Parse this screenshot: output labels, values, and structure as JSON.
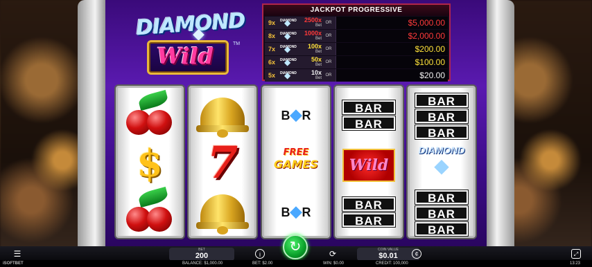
{
  "logo": {
    "title": "DIAMOND",
    "subtitle": "Wild",
    "tm": "TM"
  },
  "jackpot": {
    "title": "JACKPOT PROGRESSIVE",
    "rows": [
      {
        "mult": "9x",
        "bet": "2500x",
        "bet_label": "Bet",
        "or": "OR",
        "value": "$5,000.00",
        "color": "#ff3a3a"
      },
      {
        "mult": "8x",
        "bet": "1000x",
        "bet_label": "Bet",
        "or": "OR",
        "value": "$2,000.00",
        "color": "#ff3a3a"
      },
      {
        "mult": "7x",
        "bet": "100x",
        "bet_label": "Bet",
        "or": "OR",
        "value": "$200.00",
        "color": "#ffe23a"
      },
      {
        "mult": "6x",
        "bet": "50x",
        "bet_label": "Bet",
        "or": "OR",
        "value": "$100.00",
        "color": "#ffe23a"
      },
      {
        "mult": "5x",
        "bet": "10x",
        "bet_label": "Bet",
        "or": "OR",
        "value": "$20.00",
        "color": "#f2f2f2"
      }
    ],
    "gem_label": "DIAMOND"
  },
  "reels": {
    "r1": [
      "cherry",
      "dollar",
      "cherry"
    ],
    "r2": [
      "bell",
      "seven",
      "bell"
    ],
    "r3": [
      "bar-diamond",
      "free-games",
      "bar-diamond"
    ],
    "r4": [
      "double-bar",
      "wild",
      "double-bar"
    ],
    "r5": [
      "triple-bar",
      "diamond-logo",
      "triple-bar"
    ]
  },
  "symbols": {
    "bar": "BAR",
    "dollar": "$",
    "seven": "7",
    "b_letter": "B",
    "r_letter": "R",
    "free": "FREE",
    "games": "GAMES",
    "wild": "Wild",
    "diamond": "DIAMOND"
  },
  "controls": {
    "bet_label": "BET",
    "bet_value": "200",
    "coin_label": "COIN VALUE",
    "coin_value": "$0.01"
  },
  "status": {
    "brand": "iSOFTBET",
    "balance": "BALANCE: $1,000.00",
    "bet": "BET: $2.00",
    "win": "WIN: $0.00",
    "credit": "CREDIT: 100,000",
    "time": "13:23"
  }
}
